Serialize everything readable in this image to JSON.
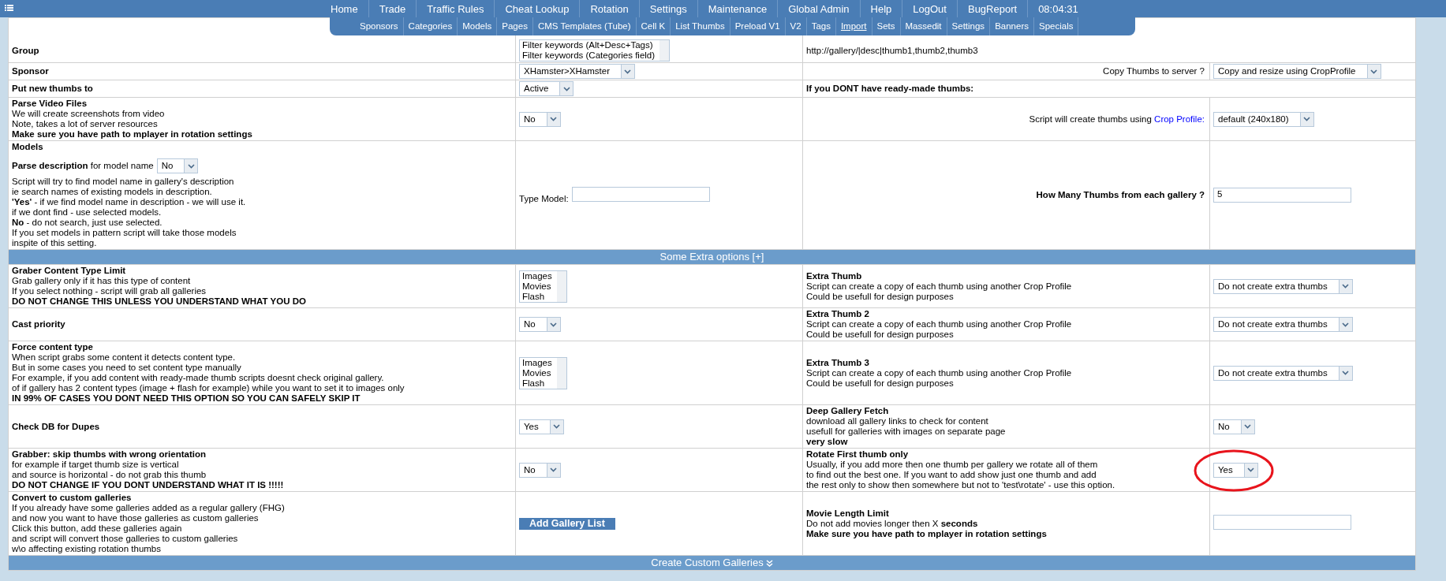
{
  "nav": {
    "items": [
      {
        "label": "Home"
      },
      {
        "label": "Trade"
      },
      {
        "label": "Traffic Rules"
      },
      {
        "label": "Cheat Lookup"
      },
      {
        "label": "Rotation"
      },
      {
        "label": "Settings"
      },
      {
        "label": "Maintenance"
      },
      {
        "label": "Global Admin"
      },
      {
        "label": "Help"
      },
      {
        "label": "LogOut"
      },
      {
        "label": "BugReport"
      }
    ],
    "clock": "08:04:31"
  },
  "subnav": [
    {
      "label": "Sponsors",
      "selected": false
    },
    {
      "label": "Categories",
      "selected": false
    },
    {
      "label": "Models",
      "selected": false
    },
    {
      "label": "Pages",
      "selected": false
    },
    {
      "label": "CMS Templates (Tube)",
      "selected": false
    },
    {
      "label": "Cell K",
      "selected": false
    },
    {
      "label": "List Thumbs",
      "selected": false
    },
    {
      "label": "Preload V1",
      "selected": false
    },
    {
      "label": "V2",
      "selected": false
    },
    {
      "label": "Tags",
      "selected": false
    },
    {
      "label": "Import",
      "selected": true
    },
    {
      "label": "Sets",
      "selected": false
    },
    {
      "label": "Massedit",
      "selected": false
    },
    {
      "label": "Settings",
      "selected": false
    },
    {
      "label": "Banners",
      "selected": false
    },
    {
      "label": "Specials",
      "selected": false
    }
  ],
  "rows": [
    {
      "kind": "group",
      "left": {
        "title": "Group"
      },
      "mid": {
        "kind": "listbox",
        "options": [
          "Filter keywords (Alt+Desc+Tags)",
          "Filter keywords (Categories field)"
        ]
      },
      "right": {
        "text": "http://gallery/|desc|thumb1,thumb2,thumb3",
        "bold": false
      }
    },
    {
      "kind": "row",
      "left": {
        "title": "Sponsor"
      },
      "mid": {
        "kind": "select",
        "value": "XHamster>XHamster",
        "circled": false
      },
      "right": {
        "text": "Copy Thumbs to server ?",
        "bold": false
      },
      "end": {
        "kind": "select",
        "value": "Copy and resize using CropProfile",
        "circled": false
      }
    },
    {
      "kind": "row",
      "left": {
        "title": "Put new thumbs to"
      },
      "mid": {
        "kind": "select",
        "value": "Active",
        "circled": false
      },
      "right": {
        "text": "If you DONT have ready-made thumbs:",
        "bold": true
      }
    },
    {
      "kind": "row",
      "left": {
        "title": "Parse Video Files",
        "lines": [
          {
            "text": "We will create screenshots from video",
            "bold": false
          },
          {
            "text": "Note, takes a lot of server resources",
            "bold": false
          },
          {
            "text": "Make sure you have path to mplayer in rotation settings",
            "bold": true
          }
        ]
      },
      "mid": {
        "kind": "select",
        "value": "No",
        "circled": false
      },
      "right": {
        "text": "Script will create thumbs using ",
        "link": "Crop Profile:",
        "bold": false
      },
      "end": {
        "kind": "select",
        "value": "default (240x180)",
        "circled": false
      }
    },
    {
      "kind": "row",
      "left": {
        "title": "Models",
        "inline": {
          "label": "**Parse description** for model name",
          "value": "No"
        },
        "lines": [
          {
            "text": "Script will try to find model name in gallery's description",
            "bold": false
          },
          {
            "text": "ie search names of existing models in description.",
            "bold": false
          },
          {
            "text": "**'Yes'** - if we find model name in description - we will use it.",
            "bold": false
          },
          {
            "text": "if we dont find - use selected models.",
            "bold": false
          },
          {
            "text": "**No** - do not search, just use selected.",
            "bold": false
          },
          {
            "text": "If you set models in pattern script will take those models",
            "bold": false
          },
          {
            "text": "inspite of this setting.",
            "bold": false
          }
        ]
      },
      "mid": {
        "kind": "input",
        "label": "Type Model:",
        "circled": false
      },
      "right": {
        "text": "How Many Thumbs from each gallery ?",
        "bold": true
      },
      "end": {
        "kind": "input",
        "value": "5",
        "circled": false
      }
    },
    {
      "kind": "header",
      "text": "Some Extra options [+]",
      "expand_icon": false
    },
    {
      "kind": "row",
      "left": {
        "title": "Graber Content Type Limit",
        "lines": [
          {
            "text": "Grab gallery only if it has this type of content",
            "bold": false
          },
          {
            "text": "If you select nothing - script will grab all galleries",
            "bold": false
          },
          {
            "text": "DO NOT CHANGE THIS UNLESS YOU UNDERSTAND WHAT YOU DO",
            "bold": true
          }
        ]
      },
      "mid": {
        "kind": "listbox",
        "options": [
          "Images",
          "Movies",
          "Flash"
        ]
      },
      "right": {
        "title": "Extra Thumb",
        "lines": [
          {
            "text": "Script can create a copy of each thumb using another Crop Profile",
            "bold": false
          },
          {
            "text": "Could be usefull for design purposes",
            "bold": false
          }
        ]
      },
      "end": {
        "kind": "select",
        "value": "Do not create extra thumbs",
        "circled": false
      }
    },
    {
      "kind": "row",
      "left": {
        "title": "Cast priority"
      },
      "mid": {
        "kind": "select",
        "value": "No",
        "circled": false
      },
      "right": {
        "title": "Extra Thumb 2",
        "lines": [
          {
            "text": "Script can create a copy of each thumb using another Crop Profile",
            "bold": false
          },
          {
            "text": "Could be usefull for design purposes",
            "bold": false
          }
        ]
      },
      "end": {
        "kind": "select",
        "value": "Do not create extra thumbs",
        "circled": false
      }
    },
    {
      "kind": "row",
      "left": {
        "title": "Force content type",
        "lines": [
          {
            "text": "When script grabs some content it detects content type.",
            "bold": false
          },
          {
            "text": "But in some cases you need to set content type manually",
            "bold": false
          },
          {
            "text": "For example, if you add content with ready-made thumb scripts doesnt check original gallery.",
            "bold": false
          },
          {
            "text": "of if gallery has 2 content types (image + flash for example) while you want to set it to images only",
            "bold": false
          },
          {
            "text": "IN 99% OF CASES YOU DONT NEED THIS OPTION SO YOU CAN SAFELY SKIP IT",
            "bold": true
          }
        ]
      },
      "mid": {
        "kind": "listbox",
        "options": [
          "Images",
          "Movies",
          "Flash"
        ]
      },
      "right": {
        "title": "Extra Thumb 3",
        "lines": [
          {
            "text": "Script can create a copy of each thumb using another Crop Profile",
            "bold": false
          },
          {
            "text": "Could be usefull for design purposes",
            "bold": false
          }
        ]
      },
      "end": {
        "kind": "select",
        "value": "Do not create extra thumbs",
        "circled": false
      }
    },
    {
      "kind": "row",
      "left": {
        "title": "Check DB for Dupes"
      },
      "mid": {
        "kind": "select",
        "value": "Yes",
        "circled": false
      },
      "right": {
        "title": "Deep Gallery Fetch",
        "lines": [
          {
            "text": "download all gallery links to check for content",
            "bold": false
          },
          {
            "text": "usefull for galleries with images on separate page",
            "bold": false
          },
          {
            "text": "very slow",
            "bold": true
          }
        ]
      },
      "end": {
        "kind": "select",
        "value": "No",
        "circled": false
      }
    },
    {
      "kind": "row",
      "left": {
        "title": "Grabber: skip thumbs with wrong orientation",
        "lines": [
          {
            "text": "for example if target thumb size is vertical",
            "bold": false
          },
          {
            "text": "and source is horizontal - do not grab this thumb",
            "bold": false
          },
          {
            "text": "DO NOT CHANGE IF YOU DONT UNDERSTAND WHAT IT IS !!!!!",
            "bold": true
          }
        ]
      },
      "mid": {
        "kind": "select",
        "value": "No",
        "circled": false
      },
      "right": {
        "title": "Rotate First thumb only",
        "lines": [
          {
            "text": "Usually, if you add more then one thumb per gallery we rotate all of them",
            "bold": false
          },
          {
            "text": "to find out the best one. If you want to add show just one thumb and add",
            "bold": false
          },
          {
            "text": "the rest only to show then somewhere but not to 'test\\rotate' - use this option.",
            "bold": false
          }
        ]
      },
      "end": {
        "kind": "select",
        "value": "Yes",
        "circled": true
      }
    },
    {
      "kind": "row",
      "left": {
        "title": "Convert to custom galleries",
        "lines": [
          {
            "text": "If you already have some galleries added as a regular gallery (FHG)",
            "bold": false
          },
          {
            "text": "and now you want to have those galleries as custom galleries",
            "bold": false
          },
          {
            "text": "Click this button, add these galleries again",
            "bold": false
          },
          {
            "text": "and script will convert those galleries to custom galleries",
            "bold": false
          },
          {
            "text": "w\\o affecting existing rotation thumbs",
            "bold": false
          }
        ]
      },
      "mid": {
        "kind": "button",
        "label": "Add Gallery List"
      },
      "right": {
        "title": "Movie Length Limit",
        "lines": [
          {
            "text": "Do not add movies longer then X **seconds**",
            "bold": false
          },
          {
            "text": "Make sure you have path to mplayer in rotation settings",
            "bold": true
          }
        ]
      },
      "end": {
        "kind": "input",
        "circled": false
      }
    },
    {
      "kind": "header",
      "text": "Create Custom Galleries",
      "expand_icon": true
    }
  ]
}
